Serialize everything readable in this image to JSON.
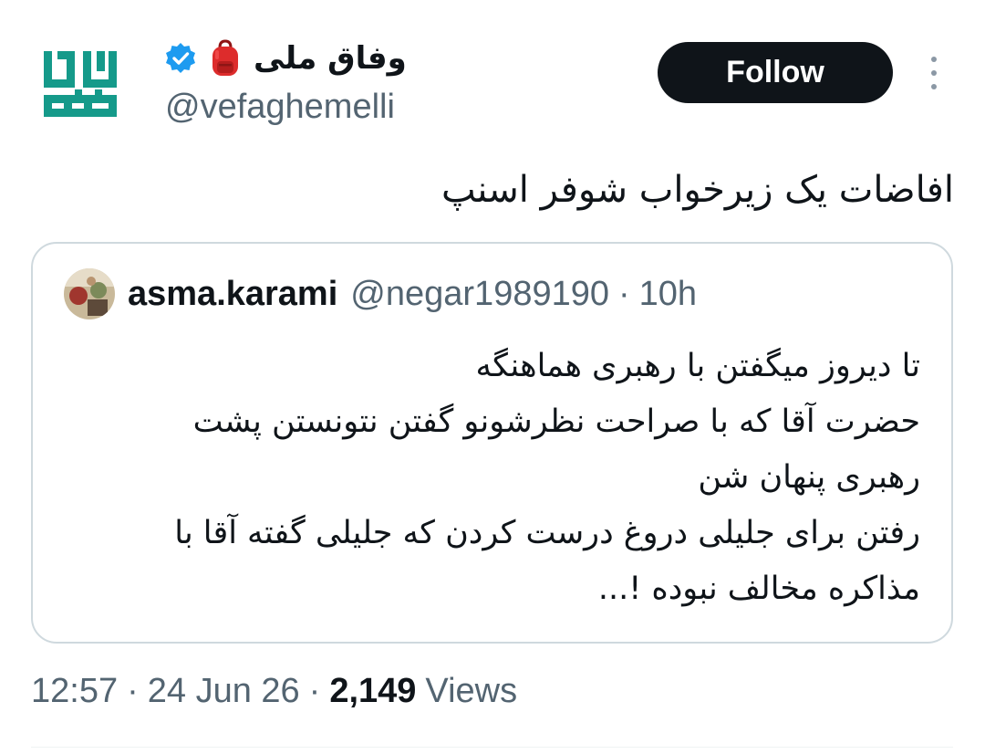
{
  "tweet": {
    "author": {
      "display_name": "وفاق ملی",
      "handle": "@vefaghemelli",
      "verified": true,
      "emoji": "backpack",
      "logo_icon": "vefagh-melli-logo",
      "logo_color": "#159a8a"
    },
    "follow_label": "Follow",
    "more_icon": "more-vertical-icon",
    "text": "افاضات یک زیرخواب شوفر اسنپ",
    "quote": {
      "author_name": "asma.karami",
      "handle": "@negar1989190",
      "separator": "·",
      "time": "10h",
      "lines": [
        "تا دیروز میگفتن با رهبری هماهنگه",
        "حضرت آقا که با صراحت نظرشونو گفتن نتونستن پشت",
        "رهبری پنهان شن",
        "رفتن برای جلیلی دروغ درست کردن که جلیلی گفته آقا با",
        "مذاکره مخالف نبوده !..."
      ]
    },
    "meta": {
      "time": "12:57",
      "separator": "·",
      "date": "24 Jun 26",
      "views_count": "2,149",
      "views_label": "Views"
    }
  },
  "colors": {
    "text_primary": "#0f1419",
    "text_secondary": "#536471",
    "verified_badge": "#1d9bf0",
    "follow_bg": "#0f1419",
    "border": "#cfd9de",
    "logo": "#159a8a"
  }
}
